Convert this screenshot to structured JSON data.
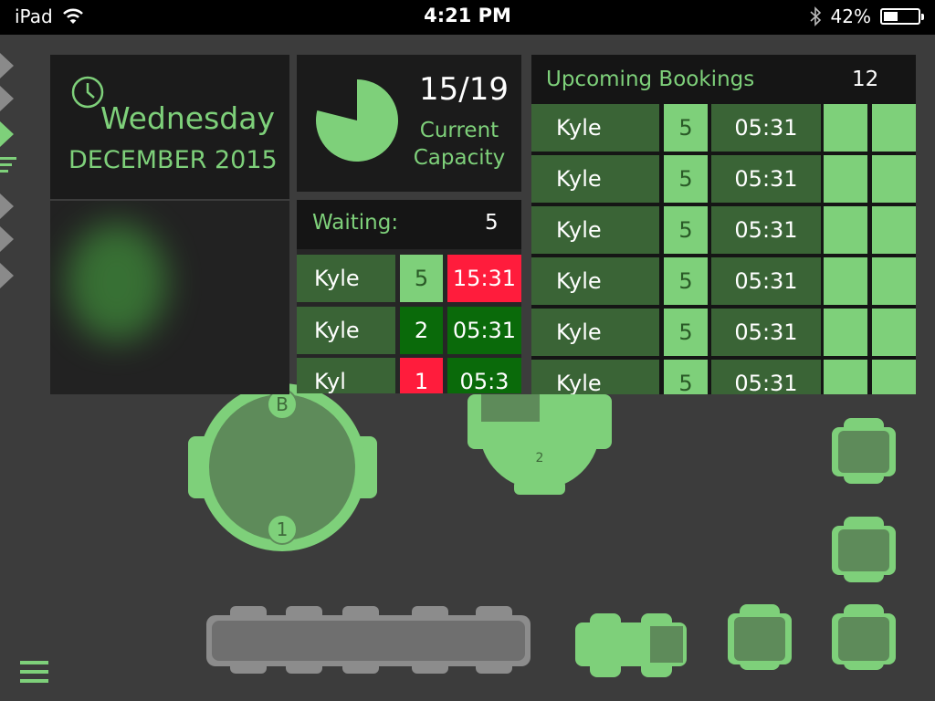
{
  "status_bar": {
    "carrier": "iPad",
    "time": "4:21 PM",
    "battery_percent_text": "42%",
    "battery_level": 0.42
  },
  "date_panel": {
    "weekday": "Wednesday",
    "month_year": "DECEMBER 2015"
  },
  "capacity": {
    "value": "15/19",
    "label": "Current Capacity",
    "current": 15,
    "total": 19
  },
  "waiting": {
    "label": "Waiting:",
    "count": "5",
    "rows": [
      {
        "name": "Kyle",
        "size": "5",
        "time": "15:31"
      },
      {
        "name": "Kyle",
        "size": "2",
        "time": "05:31"
      },
      {
        "name": "Kyl",
        "size": "1",
        "time": "05:3"
      }
    ]
  },
  "bookings": {
    "title": "Upcoming Bookings",
    "count": "12",
    "rows": [
      {
        "name": "Kyle",
        "size": "5",
        "time": "05:31"
      },
      {
        "name": "Kyle",
        "size": "5",
        "time": "05:31"
      },
      {
        "name": "Kyle",
        "size": "5",
        "time": "05:31"
      },
      {
        "name": "Kyle",
        "size": "5",
        "time": "05:31"
      },
      {
        "name": "Kyle",
        "size": "5",
        "time": "05:31"
      },
      {
        "name": "Kyle",
        "size": "5",
        "time": "05:31"
      }
    ]
  },
  "floor_plan": {
    "round_table_top_label": "B",
    "round_table_bottom_label": "1",
    "half_round_table_label": "2"
  },
  "colors": {
    "accent": "#7ed07a",
    "dark_green": "#3a6436",
    "alert_red": "#ff1c3c",
    "background": "#3c3c3c"
  }
}
